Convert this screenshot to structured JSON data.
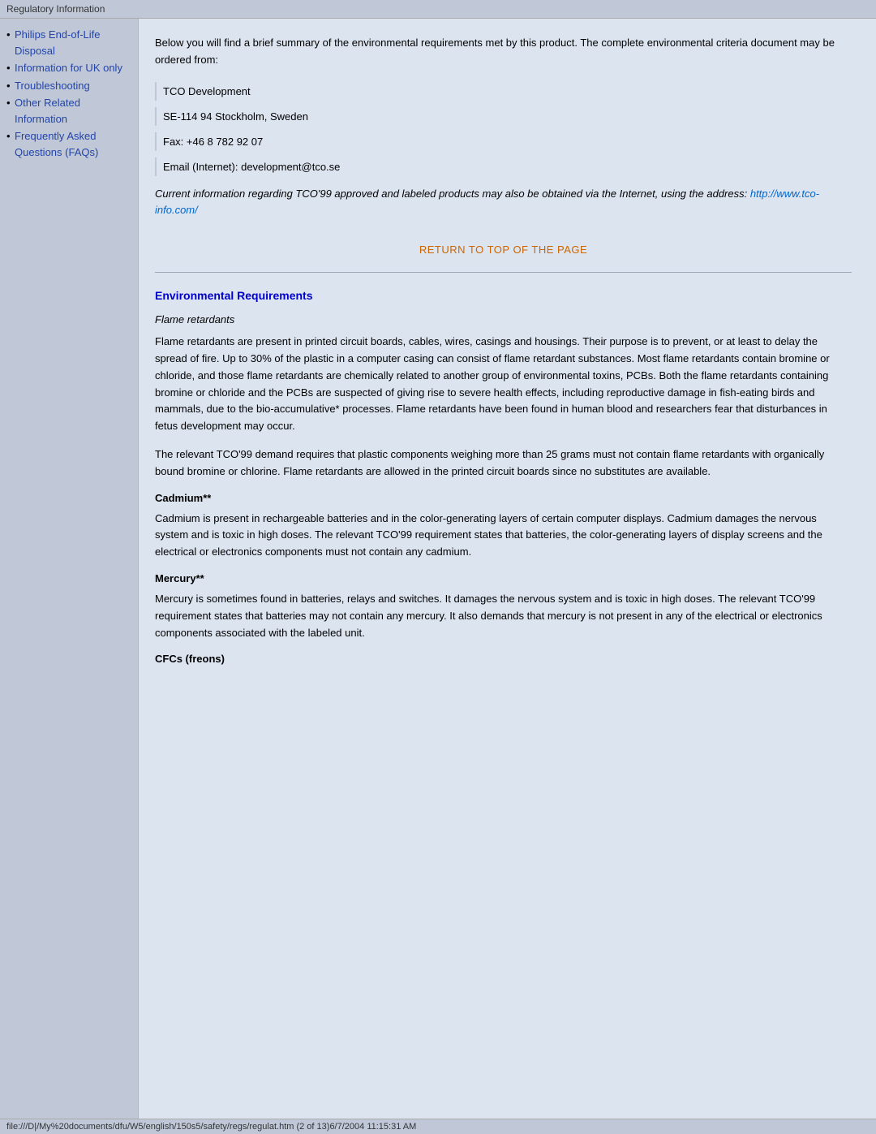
{
  "topbar": {
    "title": "Regulatory Information"
  },
  "sidebar": {
    "items": [
      {
        "label": "Philips End-of-Life Disposal",
        "href": "#"
      },
      {
        "label": "Information for UK only",
        "href": "#"
      },
      {
        "label": "Troubleshooting",
        "href": "#"
      },
      {
        "label": "Other Related Information",
        "href": "#"
      },
      {
        "label": "Frequently Asked Questions (FAQs)",
        "href": "#"
      }
    ]
  },
  "content": {
    "intro": "Below you will find a brief summary of the environmental requirements met by this product. The complete environmental criteria document may be ordered from:",
    "address": {
      "line1": "TCO Development",
      "line2": "SE-114 94 Stockholm, Sweden",
      "line3": "Fax: +46 8 782 92 07",
      "line4": "Email (Internet): development@tco.se"
    },
    "italic_note_text": "Current information regarding TCO'99 approved and labeled products may also be obtained via the Internet, using the address: ",
    "italic_note_link": "http://www.tco-info.com/",
    "return_to_top": "RETURN TO TOP OF THE PAGE",
    "section_title": "Environmental Requirements",
    "flame_retardants_label": "Flame retardants",
    "flame_para1": "Flame retardants are present in printed circuit boards, cables, wires, casings and housings. Their purpose is to prevent, or at least to delay the spread of fire. Up to 30% of the plastic in a computer casing can consist of flame retardant substances. Most flame retardants contain bromine or chloride, and those flame retardants are chemically related to another group of environmental toxins, PCBs. Both the flame retardants containing bromine or chloride and the PCBs are suspected of giving rise to severe health effects, including reproductive damage in fish-eating birds and mammals, due to the bio-accumulative* processes. Flame retardants have been found in human blood and researchers fear that disturbances in fetus development may occur.",
    "flame_para2": "The relevant TCO'99 demand requires that plastic components weighing more than 25 grams must not contain flame retardants with organically bound bromine or chlorine. Flame retardants are allowed in the printed circuit boards since no substitutes are available.",
    "cadmium_label": "Cadmium**",
    "cadmium_para": "Cadmium is present in rechargeable batteries and in the color-generating layers of certain computer displays. Cadmium damages the nervous system and is toxic in high doses. The relevant TCO'99 requirement states that batteries, the color-generating layers of display screens and the electrical or electronics components must not contain any cadmium.",
    "mercury_label": "Mercury**",
    "mercury_para": "Mercury is sometimes found in batteries, relays and switches. It damages the nervous system and is toxic in high doses. The relevant TCO'99 requirement states that batteries may not contain any mercury. It also demands that mercury is not present in any of the electrical or electronics components associated with the labeled unit.",
    "cfcs_label": "CFCs (freons)"
  },
  "statusbar": {
    "text": "file:///D|/My%20documents/dfu/W5/english/150s5/safety/regs/regulat.htm (2 of 13)6/7/2004 11:15:31 AM"
  }
}
